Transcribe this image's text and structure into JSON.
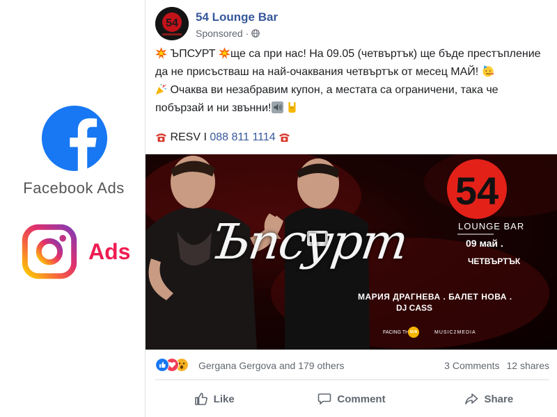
{
  "left_panel": {
    "facebook_label": "Facebook Ads",
    "instagram_label": "Ads"
  },
  "post": {
    "page_name": "54 Lounge Bar",
    "sponsored_label": "Sponsored",
    "text_line1_a": " ЪПСУРТ ",
    "text_line1_b": "ще са при нас! На 09.05 (четвъртък) ще бъде престъпление да не присъстваш на най-очаквания четвъртък от месец МАЙ! ",
    "text_line2": "Очаква ви незабравим купон, а местата са ограничени, така че побързай и ни звънни!",
    "rsv_label": " RESV I ",
    "phone": "088 811 1114",
    "avatar_text": "54"
  },
  "ad_image": {
    "title": "Ъпсурт",
    "logo_number": "54",
    "lounge_label": "LOUNGE BAR",
    "date": "09 май .",
    "day": "ЧЕТВЪРТЪК",
    "artists": "МАРИЯ ДРАГНЕВА . БАЛЕТ НОВА .",
    "dj": "DJ CASS",
    "sponsor1": "FACING THE",
    "sponsor1_badge": "SUN",
    "sponsor2": "MUSIC2MEDIA"
  },
  "engagement": {
    "reactors": "Gergana Gergova and 179 others",
    "comments": "3 Comments",
    "shares": "12 shares"
  },
  "actions": {
    "like": "Like",
    "comment": "Comment",
    "share": "Share"
  },
  "colors": {
    "facebook_blue": "#1877f2",
    "link_blue": "#365899",
    "instagram_pink": "#ee1d52",
    "logo_red": "#e32119"
  }
}
